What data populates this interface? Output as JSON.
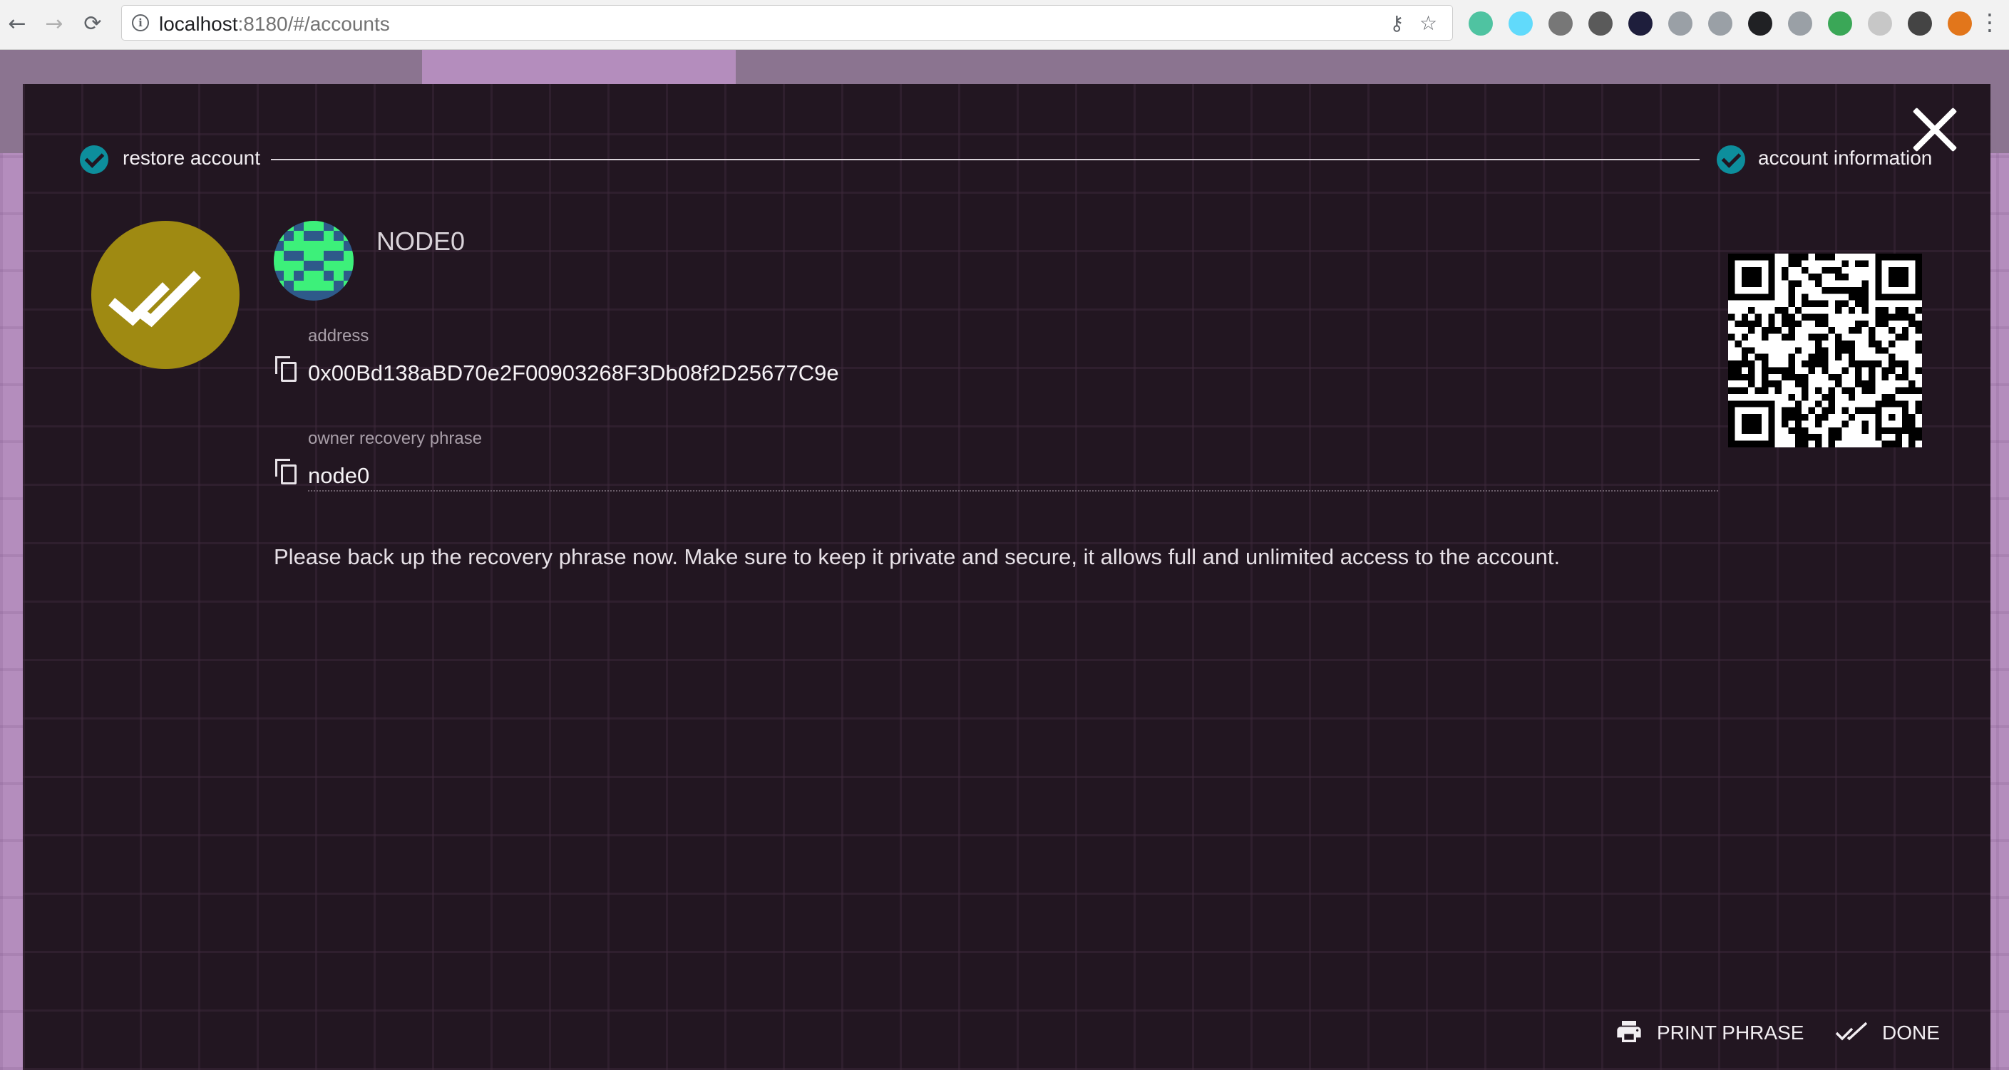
{
  "browser": {
    "url_host": "localhost",
    "url_rest": ":8180/#/accounts",
    "icons": [
      "back-arrow-icon",
      "forward-arrow-icon",
      "reload-icon",
      "info-icon",
      "key-icon",
      "star-icon",
      "kebab-menu-icon"
    ],
    "extension_colors": [
      "#4fc3a1",
      "#61dafb",
      "#777777",
      "#5a5a5a",
      "#1e1e3c",
      "#9aa0a6",
      "#9aa0a6",
      "#202124",
      "#9aa0a6",
      "#3aa757",
      "#c7c7c7",
      "#444444",
      "#e2761b"
    ]
  },
  "wizard": {
    "steps": [
      {
        "label": "restore account",
        "state": "done"
      },
      {
        "label": "account information",
        "state": "done"
      }
    ],
    "account": {
      "name": "NODE0",
      "address_label": "address",
      "address": "0x00Bd138aBD70e2F00903268F3Db08f2D25677C9e",
      "phrase_label": "owner recovery phrase",
      "phrase": "node0"
    },
    "notice": "Please back up the recovery phrase now. Make sure to keep it private and secure, it allows full and unlimited access to the account.",
    "actions": {
      "print_label": "PRINT PHRASE",
      "done_label": "DONE"
    }
  },
  "colors": {
    "modal_bg": "#221621",
    "step_check": "#0d8e9c",
    "badge": "#9f8a12",
    "identicon_fg": "#3df07a",
    "identicon_bg": "#2e5a8a",
    "app_bg": "#b48dbd"
  }
}
